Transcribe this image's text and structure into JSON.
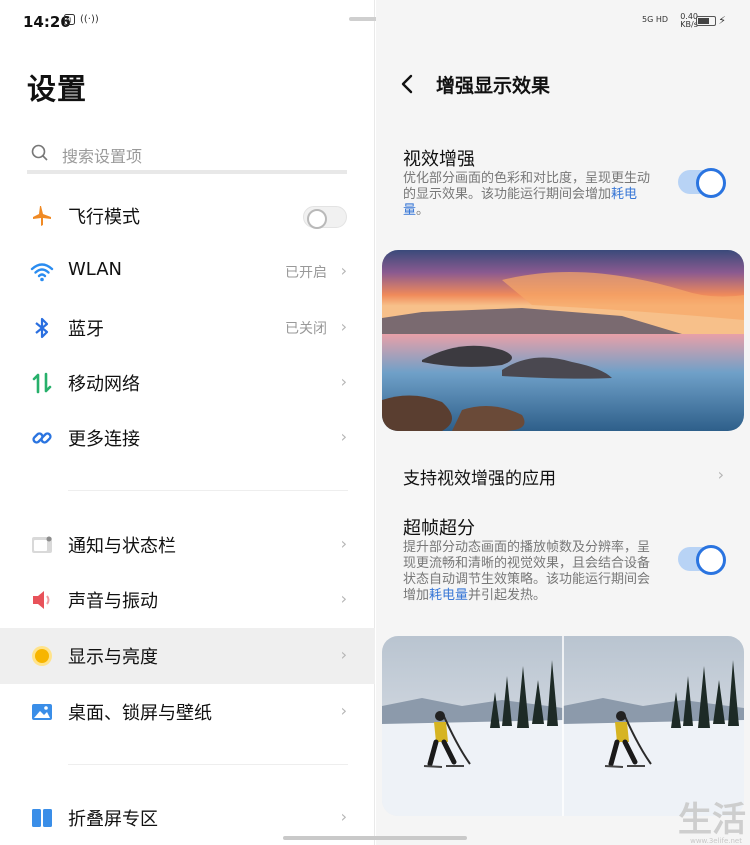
{
  "status": {
    "time": "14:26",
    "net_speed": "0.40",
    "net_unit": "KB/s",
    "signal": "5G HD"
  },
  "settings": {
    "title": "设置",
    "search_placeholder": "搜索设置项",
    "items": [
      {
        "label": "飞行模式",
        "value": ""
      },
      {
        "label": "WLAN",
        "value": "已开启"
      },
      {
        "label": "蓝牙",
        "value": "已关闭"
      },
      {
        "label": "移动网络",
        "value": ""
      },
      {
        "label": "更多连接",
        "value": ""
      },
      {
        "label": "通知与状态栏",
        "value": ""
      },
      {
        "label": "声音与振动",
        "value": ""
      },
      {
        "label": "显示与亮度",
        "value": ""
      },
      {
        "label": "桌面、锁屏与壁纸",
        "value": ""
      },
      {
        "label": "折叠屏专区",
        "value": ""
      }
    ]
  },
  "detail": {
    "title": "增强显示效果",
    "visual": {
      "title": "视效增强",
      "desc_main": "优化部分画面的色彩和对比度，呈现更生动的显示效果。该功能运行期间会增加",
      "desc_link": "耗电量",
      "desc_end": "。",
      "enabled": true
    },
    "apps_link": "支持视效增强的应用",
    "frame": {
      "title": "超帧超分",
      "desc_main": "提升部分动态画面的播放帧数及分辨率，呈现更流畅和清晰的视觉效果，且会结合设备状态自动调节生效策略。该功能运行期间会增加",
      "desc_link": "耗电量",
      "desc_end": "并引起发热。",
      "enabled": true
    }
  },
  "watermark": {
    "text": "生活",
    "site": "www.3elife.net"
  },
  "colors": {
    "accent": "#2a74e0",
    "wifi": "#2a8cf0",
    "bluetooth": "#2a6fe0",
    "airplane": "#f08a24",
    "mobile": "#27b06b",
    "link": "#2a74e0",
    "sound": "#e8525a",
    "display": "#f7b500"
  }
}
